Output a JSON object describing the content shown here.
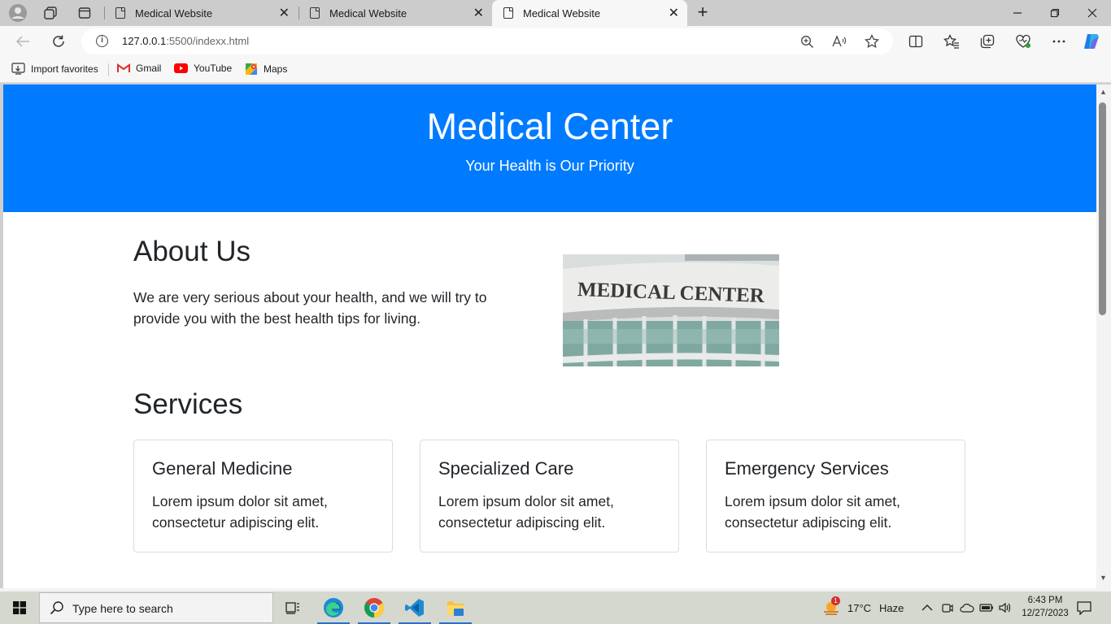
{
  "browser": {
    "tabs": [
      {
        "title": "Medical Website",
        "active": false
      },
      {
        "title": "Medical Website",
        "active": false
      },
      {
        "title": "Medical Website",
        "active": true
      }
    ],
    "address": {
      "host": "127.0.0.1",
      "path": ":5500/indexx.html"
    },
    "favorites": [
      {
        "label": "Import favorites",
        "icon": "import-icon"
      },
      {
        "label": "Gmail",
        "icon": "gmail-icon"
      },
      {
        "label": "YouTube",
        "icon": "youtube-icon"
      },
      {
        "label": "Maps",
        "icon": "maps-icon"
      }
    ]
  },
  "page": {
    "hero": {
      "title": "Medical Center",
      "subtitle": "Your Health is Our Priority",
      "background": "#007bff"
    },
    "about": {
      "heading": "About Us",
      "text": "We are very serious about your health, and we will try to provide you with the best health tips for living.",
      "image_sign": "MEDICAL CENTER"
    },
    "services": {
      "heading": "Services",
      "cards": [
        {
          "title": "General Medicine",
          "text": "Lorem ipsum dolor sit amet, consectetur adipiscing elit."
        },
        {
          "title": "Specialized Care",
          "text": "Lorem ipsum dolor sit amet, consectetur adipiscing elit."
        },
        {
          "title": "Emergency Services",
          "text": "Lorem ipsum dolor sit amet, consectetur adipiscing elit."
        }
      ]
    }
  },
  "taskbar": {
    "search_placeholder": "Type here to search",
    "weather": {
      "temp": "17°C",
      "condition": "Haze",
      "badge": "1"
    },
    "time": "6:43 PM",
    "date": "12/27/2023"
  }
}
